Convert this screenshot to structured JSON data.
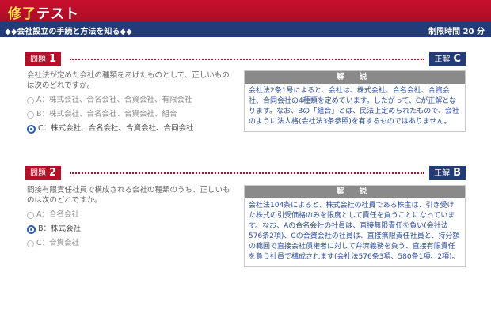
{
  "header": {
    "title_accent": "修了",
    "title_main": "テスト"
  },
  "subbar": {
    "section": "◆◆会社設立の手続と方法を知る◆◆",
    "timer": "制限時間 20 分"
  },
  "questions": [
    {
      "tag": "問題",
      "number": "1",
      "answer_label": "正解",
      "answer_letter": "C",
      "text": "会社法が定めた会社の種類をあげたものとして、正しいものは次のどれですか。",
      "options": [
        "A：株式会社、合名会社、合資会社、有限会社",
        "B：株式会社、合名会社、合資会社、組合",
        "C：株式会社、合名会社、合資会社、合同会社"
      ],
      "selected_index": 2,
      "explanation_title": "解 説",
      "explanation": "会社法2条1号によると、会社は、株式会社、合名会社、合資会社、合同会社の4種類を定めています。したがって、Cが正解となります。なお、Bの「組合」とは、民法上定められたもので、会社のように法人格(会社法3条参照)を有するものではありません。"
    },
    {
      "tag": "問題",
      "number": "2",
      "answer_label": "正解",
      "answer_letter": "B",
      "text": "間接有限責任社員で構成される会社の種類のうち、正しいものは次のどれですか。",
      "options": [
        "A：合名会社",
        "B：株式会社",
        "C：合資会社"
      ],
      "selected_index": 1,
      "explanation_title": "解 説",
      "explanation": "会社法104条によると、株式会社の社員である株主は、引き受けた株式の引受価格のみを限度として責任を負うことになっています。なお、Aの合名会社の社員は、直接無限責任を負い(会社法576条2項)、Cの合資会社の社員は、直接無限責任社員と、持分額の範囲で直接会社債権者に対して弁済義務を負う、直接有限責任を負う社員で構成されます(会社法576条3項、580条1項、2項)。"
    }
  ],
  "colors": {
    "header_red": "#b5102a",
    "navy": "#243b7a",
    "explanation_text": "#2b4d9a",
    "radio_selected": "#2a5db0"
  }
}
